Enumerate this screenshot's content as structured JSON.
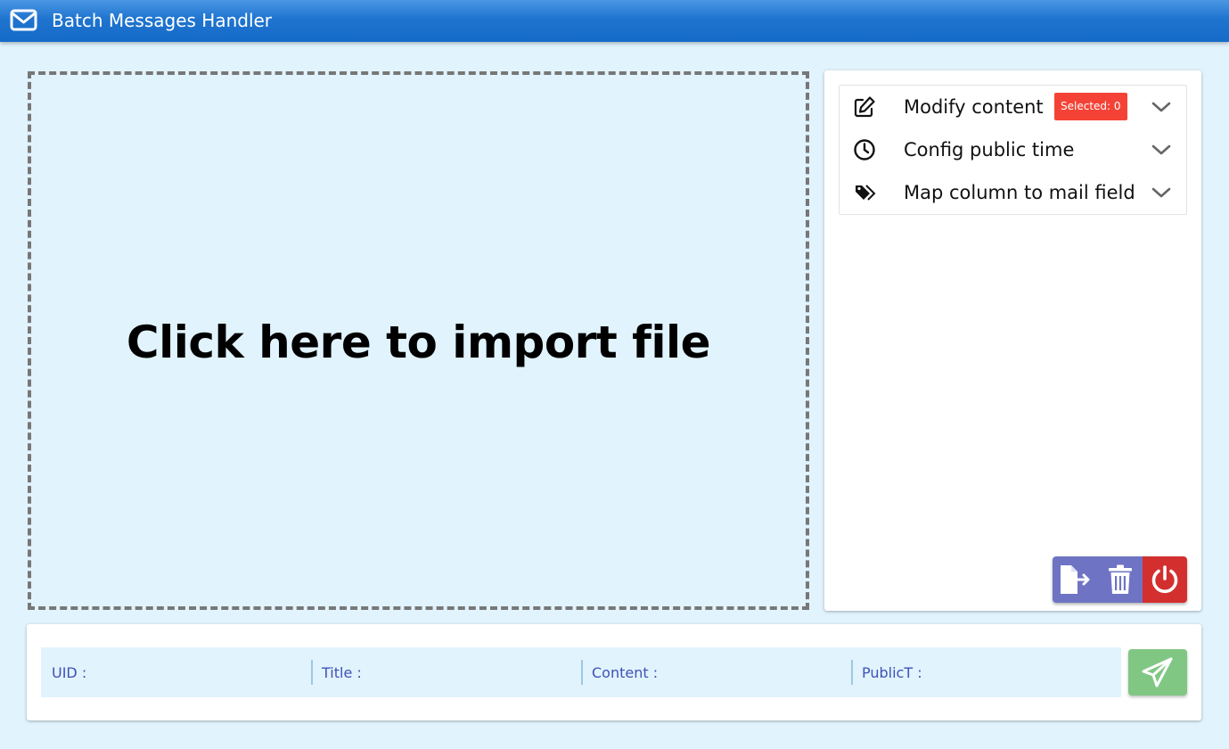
{
  "app": {
    "title": "Batch Messages Handler",
    "icon": "envelope-icon"
  },
  "dropzone": {
    "text": "Click here to import file"
  },
  "settings": {
    "items": [
      {
        "label": "Modify content",
        "icon": "edit-icon",
        "badge": "Selected: 0"
      },
      {
        "label": "Config public time",
        "icon": "clock-icon"
      },
      {
        "label": "Map column to mail field",
        "icon": "tags-icon"
      }
    ],
    "actions": [
      {
        "icon": "file-export-icon",
        "color": "#6f73c4"
      },
      {
        "icon": "trash-icon",
        "color": "#6f73c4"
      },
      {
        "icon": "power-icon",
        "color": "#d32f2f"
      }
    ]
  },
  "preview": {
    "fields": [
      {
        "label": "UID :"
      },
      {
        "label": "Title :"
      },
      {
        "label": "Content :"
      },
      {
        "label": "PublicT :"
      }
    ],
    "send_icon": "send-icon",
    "send_color": "#81c784"
  },
  "colors": {
    "titlebar": "#1f74cf",
    "background": "#e1f3fd",
    "badge": "#f44336",
    "field_label": "#3f51b5"
  }
}
